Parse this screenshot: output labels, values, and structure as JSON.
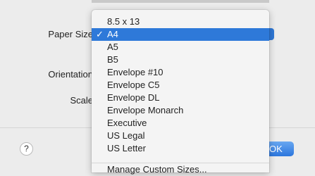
{
  "dialog": {
    "paper_size_label": "Paper Size",
    "orientation_label": "Orientation",
    "scale_label": "Scale",
    "help_label": "?",
    "ok_label": "OK"
  },
  "menu": {
    "check_glyph": "✓",
    "items": [
      {
        "label": "8.5 x 13",
        "selected": false
      },
      {
        "label": "A4",
        "selected": true
      },
      {
        "label": "A5",
        "selected": false
      },
      {
        "label": "B5",
        "selected": false
      },
      {
        "label": "Envelope #10",
        "selected": false
      },
      {
        "label": "Envelope C5",
        "selected": false
      },
      {
        "label": "Envelope DL",
        "selected": false
      },
      {
        "label": "Envelope Monarch",
        "selected": false
      },
      {
        "label": "Executive",
        "selected": false
      },
      {
        "label": "US Legal",
        "selected": false
      },
      {
        "label": "US Letter",
        "selected": false
      }
    ],
    "manage_label": "Manage Custom Sizes..."
  },
  "colors": {
    "accent": "#2e79d9",
    "background": "#ececec"
  }
}
